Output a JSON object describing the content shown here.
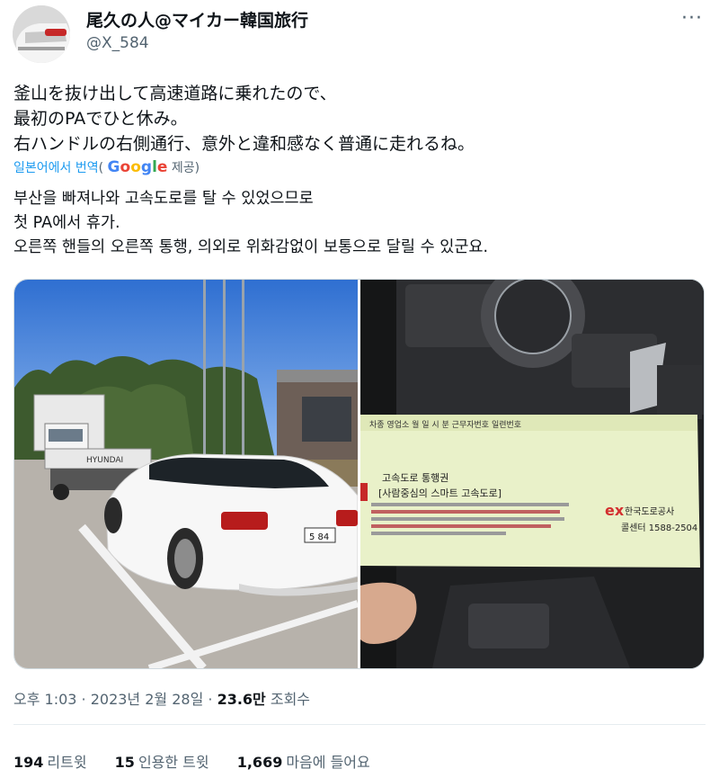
{
  "user": {
    "name": "尾久の人@マイカー韓国旅行",
    "handle": "@X_584",
    "more_icon": "more-icon"
  },
  "tweet": {
    "text": "釜山を抜け出して高速道路に乗れたので、\n最初のPAでひと休み。\n右ハンドルの右側通行、意外と違和感なく普通に走れるね。"
  },
  "translation": {
    "label": "일본어에서 번역",
    "by_open": "(",
    "provider": "Google",
    "by_close": "제공)",
    "text": "부산을 빠져나와 고속도로를 탈 수 있었으므로\n첫 PA에서 휴가.\n오른쪽 핸들의 오른쪽 통행, 의외로 위화감없이 보통으로 달릴 수 있군요."
  },
  "media": {
    "plate": "5 84",
    "truck_brand": "HYUNDAI",
    "ticket": {
      "header": "차종  영업소  월  일  시  분  근무자번호  일련번호",
      "title": "고속도로 통행권",
      "subtitle": "[사람중심의 스마트 고속도로]",
      "logo": "ex",
      "company": "한국도로공사",
      "call_center": "콜센터 1588-2504"
    }
  },
  "meta": {
    "time": "오후 1:03 · 2023년 2월 28일 · ",
    "views": "23.6만",
    "views_label": " 조회수"
  },
  "stats": {
    "retweets": "194",
    "retweets_label": "리트윗",
    "quotes": "15",
    "quotes_label": "인용한 트윗",
    "likes": "1,669",
    "likes_label": "마음에 들어요"
  }
}
